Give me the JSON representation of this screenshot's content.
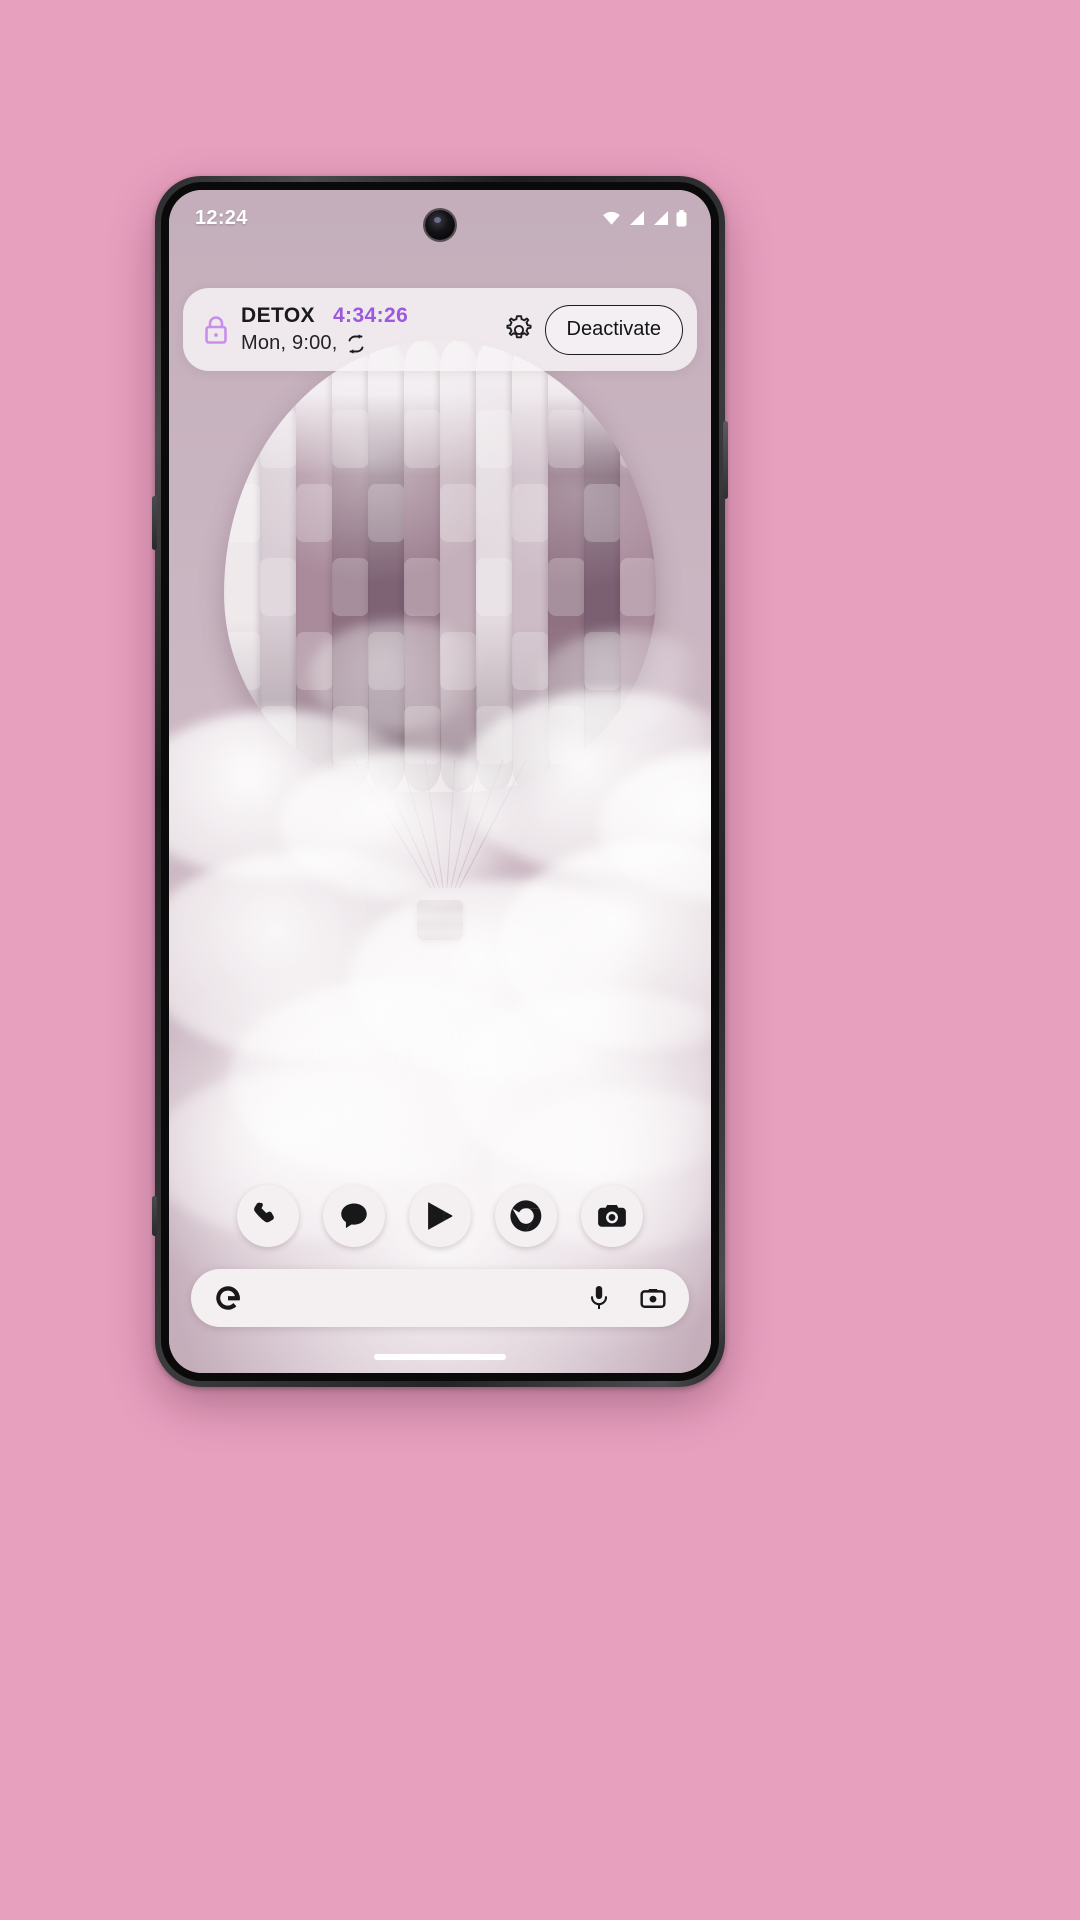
{
  "device": {
    "name": "pixel-phone",
    "background_color": "#e8a0bf"
  },
  "status_bar": {
    "clock": "12:24",
    "icons": [
      {
        "name": "wifi-icon",
        "label": "Wi-Fi"
      },
      {
        "name": "cellular-signal-icon-1",
        "label": "Signal"
      },
      {
        "name": "cellular-signal-icon-2",
        "label": "Signal"
      },
      {
        "name": "battery-icon",
        "label": "Battery"
      }
    ]
  },
  "detox_widget": {
    "icon": "lock-icon",
    "title": "DETOX",
    "timer": "4:34:26",
    "schedule": "Mon, 9:00,",
    "repeat_icon": "repeat-icon",
    "settings_icon": "gear-icon",
    "deactivate_label": "Deactivate",
    "timer_color": "#9b59e0"
  },
  "dock": {
    "items": [
      {
        "name": "dock-item-phone",
        "icon": "phone-icon",
        "label": "Phone"
      },
      {
        "name": "dock-item-messages",
        "icon": "messages-icon",
        "label": "Messages"
      },
      {
        "name": "dock-item-play-store",
        "icon": "play-store-icon",
        "label": "Play Store"
      },
      {
        "name": "dock-item-chrome",
        "icon": "chrome-icon",
        "label": "Chrome"
      },
      {
        "name": "dock-item-camera",
        "icon": "camera-icon",
        "label": "Camera"
      }
    ]
  },
  "search_bar": {
    "logo": "google-g-icon",
    "placeholder": "",
    "value": "",
    "mic_icon": "microphone-icon",
    "lens_icon": "google-lens-camera-icon"
  },
  "wallpaper": {
    "subject": "hot-air-balloon-in-clouds"
  },
  "gesture_bar": {
    "name": "home-gesture-indicator"
  }
}
